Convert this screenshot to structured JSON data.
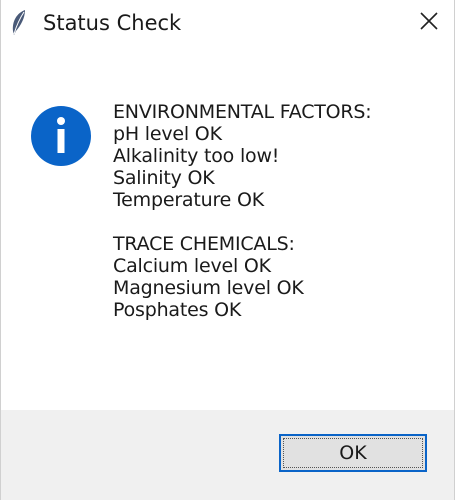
{
  "window": {
    "title": "Status Check",
    "app_icon": "feather-icon",
    "close_icon": "close-icon"
  },
  "dialog": {
    "icon": "info-icon",
    "accent_color": "#0a64c8",
    "environmental": {
      "heading": "ENVIRONMENTAL FACTORS:",
      "lines": [
        "pH level OK",
        "Alkalinity too low!",
        "Salinity OK",
        "Temperature OK"
      ]
    },
    "trace": {
      "heading": "TRACE CHEMICALS:",
      "lines": [
        "Calcium level OK",
        "Magnesium level OK",
        "Posphates OK"
      ]
    }
  },
  "footer": {
    "ok_label": "OK"
  }
}
